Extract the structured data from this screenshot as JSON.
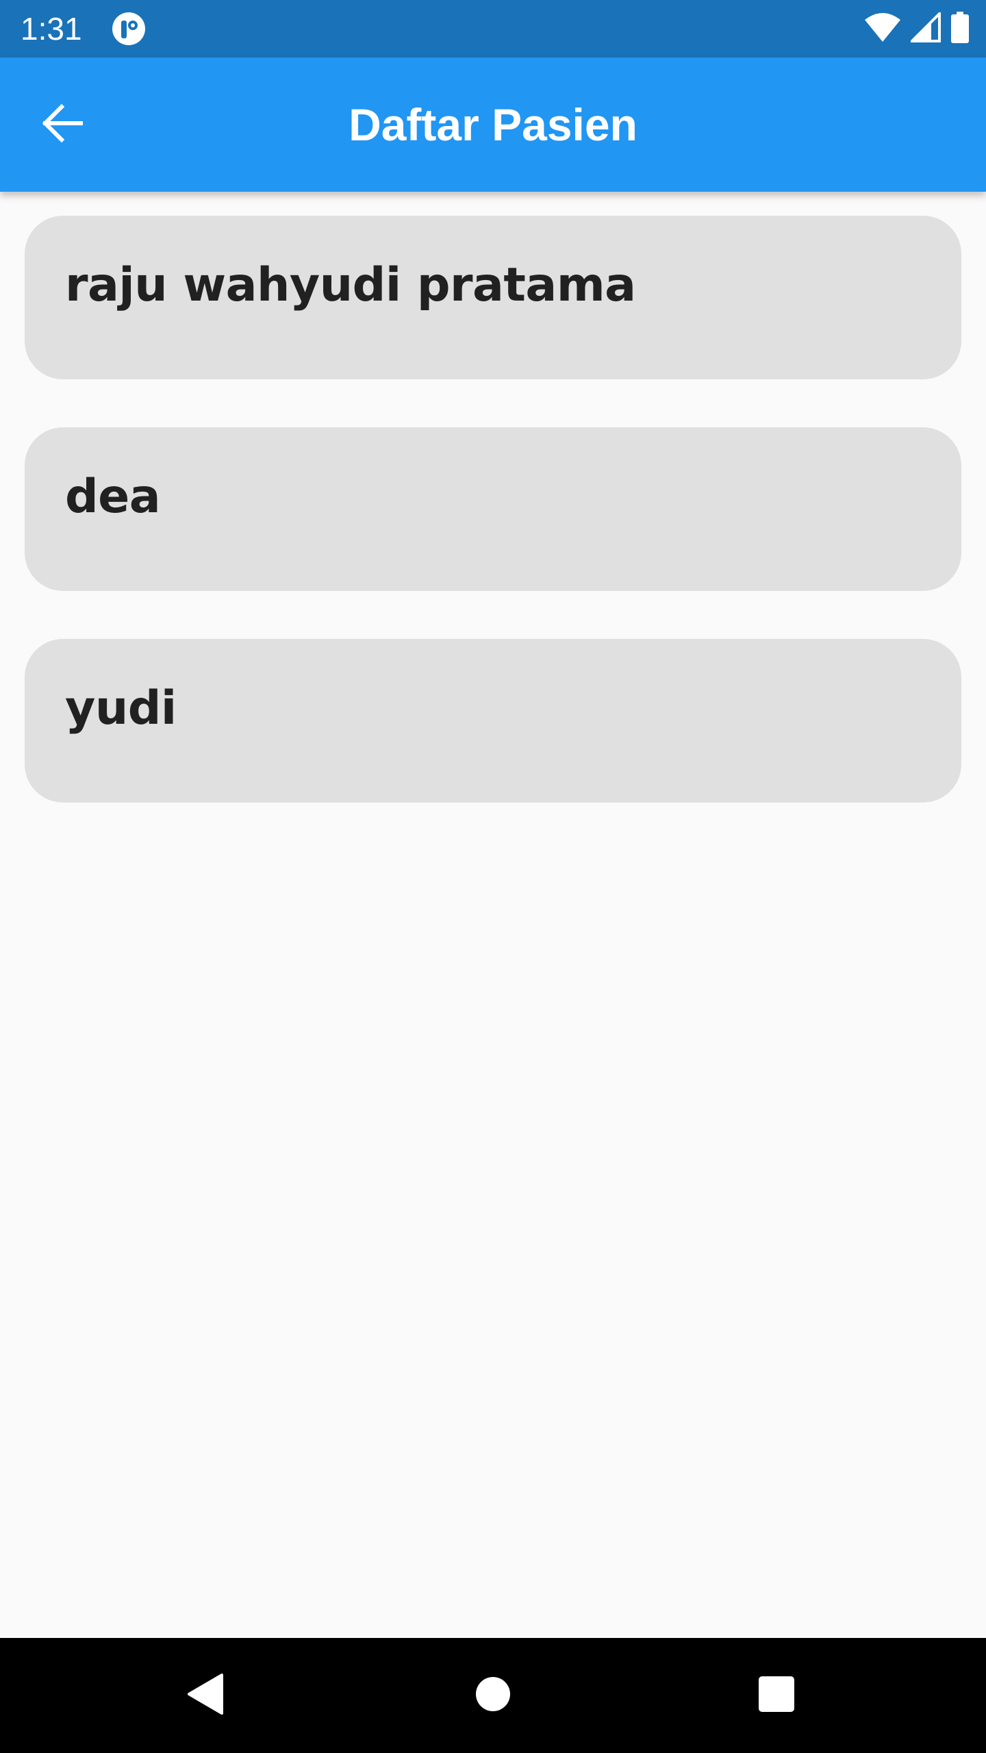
{
  "status_bar": {
    "time": "1:31",
    "background_color": "#1a72b8",
    "icons": [
      "app-notification-icon",
      "wifi-icon",
      "cell-signal-icon",
      "battery-icon"
    ]
  },
  "app_bar": {
    "title": "Daftar Pasien",
    "background_color": "#2196f3",
    "back_icon": "arrow-left-icon"
  },
  "patients": [
    {
      "name": "raju wahyudi pratama"
    },
    {
      "name": "dea"
    },
    {
      "name": "yudi"
    }
  ],
  "nav_bar": {
    "icons": [
      "back-triangle-icon",
      "home-circle-icon",
      "recents-square-icon"
    ]
  }
}
